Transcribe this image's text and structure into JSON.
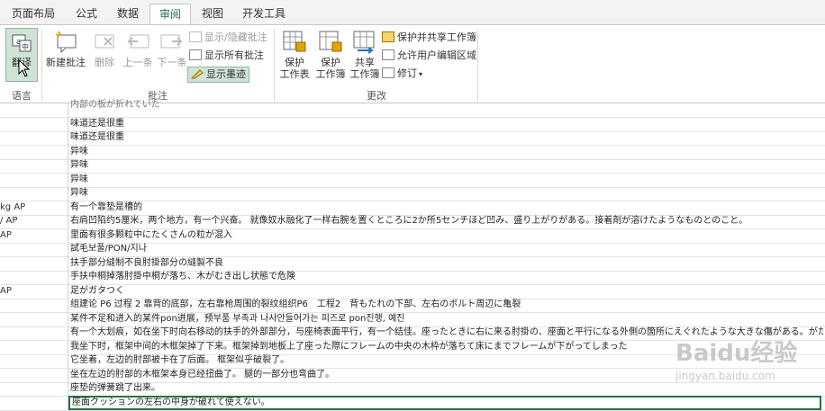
{
  "tabs": [
    {
      "label": "页面布局",
      "active": false
    },
    {
      "label": "公式",
      "active": false
    },
    {
      "label": "数据",
      "active": false
    },
    {
      "label": "审阅",
      "active": true
    },
    {
      "label": "视图",
      "active": false
    },
    {
      "label": "开发工具",
      "active": false
    }
  ],
  "ribbon": {
    "language_group": {
      "translate_label": "翻译",
      "group_label": "语言"
    },
    "comments_group": {
      "new_comment": "新建批注",
      "delete": "删除",
      "previous": "上一条",
      "next": "下一条",
      "show_hide": "显示/隐藏批注",
      "show_all": "显示所有批注",
      "show_ink": "显示墨迹",
      "group_label": "批注"
    },
    "changes_group": {
      "protect_sheet": "保护\n工作表",
      "protect_workbook": "保护\n工作簿",
      "share_workbook": "共享\n工作簿",
      "protect_share": "保护并共享工作簿",
      "allow_edit_ranges": "允许用户编辑区域",
      "track_changes": "修订",
      "group_label": "更改"
    }
  },
  "rows": [
    {
      "a": "",
      "b": "内部の板が折れていた"
    },
    {
      "a": "",
      "b": "味道还是很重"
    },
    {
      "a": "",
      "b": "味道还是很重"
    },
    {
      "a": "",
      "b": "异味"
    },
    {
      "a": "",
      "b": "异味"
    },
    {
      "a": "",
      "b": "异味"
    },
    {
      "a": "",
      "b": "异味"
    },
    {
      "a": "kg AP",
      "b": "有一个靠垫是槽的"
    },
    {
      "a": "/ AP",
      "b": "右肩凹陷约5厘米，两个地方，有一个兴奋。 就像奴水融化了一样右腕を置くところに2か所5センチほど凹み、盛り上がりがある。接着剤が溶けたようなものとのこと。"
    },
    {
      "a": "AP",
      "b": "里面有很多颗粒中にたくさんの粒が混入"
    },
    {
      "a": "",
      "b": "試毛보풀/PON/지나"
    },
    {
      "a": "",
      "b": "扶手部分縫制不良肘掛部分の縫製不良"
    },
    {
      "a": "",
      "b": "手扶中桐掉落肘掛中桐が落ち、木がむき出し状態で危険"
    },
    {
      "a": "AP",
      "b": "足がガタつく"
    },
    {
      "a": "",
      "b": "组建论 P6 过程 2 靠背的底部，左右靠枪周围的裂纹组织P6　工程2　背もたれの下部、左右のボルト周辺に亀裂"
    },
    {
      "a": "",
      "b": "某件不足和进入的某件pon进展，预부품 부족과 나사안들어가는 피즈로 pon진행, 예진"
    },
    {
      "a": "",
      "b": "有一个大划痕，如在坐下时向右移动的扶手的外部部分，与座椅表面平行，有一个结佳。座ったときに右に来る肘掛の、座面と平行になる外側の箇所にえぐれたような大きな傷がある。がたつき"
    },
    {
      "a": "",
      "b": "我坐下时，框架中间的木框架掉了下来。框架掉到地板上了座った際にフレームの中央の木枠が落ちて床にまでフレームが下がってしまった"
    },
    {
      "a": "",
      "b": "它坐着，左边的肘部被卡在了后面。 框架似乎破裂了。"
    },
    {
      "a": "",
      "b": "坐在左边的肘部的木框架本身已经扭曲了。 腿的一部分也弯曲了。"
    },
    {
      "a": "",
      "b": "座垫的弹簧跳了出来。"
    },
    {
      "a": "",
      "b": "座面クッションの左右の中身が破れて使えない。"
    }
  ],
  "watermark": {
    "brand": "Baidu经验",
    "url": "jingyan.baidu.com"
  }
}
